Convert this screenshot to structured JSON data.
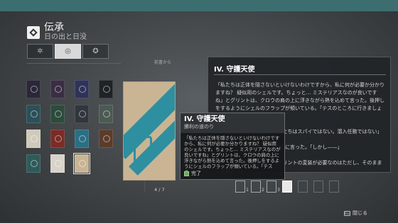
{
  "header": {
    "title": "伝承",
    "subtitle": "日の出と日没"
  },
  "filters": [
    {
      "name": "filter-tab-1",
      "glyph": "✲",
      "selected": false
    },
    {
      "name": "filter-tab-2",
      "glyph": "◎",
      "selected": true
    },
    {
      "name": "filter-tab-3",
      "glyph": "✪",
      "selected": false
    }
  ],
  "books": [
    {
      "color": "#2b2638"
    },
    {
      "color": "#3a2e44"
    },
    {
      "color": "#2f3358"
    },
    {
      "color": "#1f2226"
    },
    {
      "color": "#2a5058"
    },
    {
      "color": "#2c4b3c"
    },
    {
      "color": "#31363e"
    },
    {
      "color": "#4b5a52"
    },
    {
      "color": "#d0cabb"
    },
    {
      "color": "#7a2c25"
    },
    {
      "color": "#2a6f85"
    },
    {
      "color": "#5b3c2a"
    },
    {
      "color": "#2e5a5a"
    },
    {
      "color": "#d8d3c8"
    },
    {
      "color": "#c9b594",
      "selected": true
    }
  ],
  "previous_label": "前書から",
  "detail": {
    "title": "IV. 守護天使",
    "body": "「私たちは正体を隠さないといけないわけですから、私に何が必要か分かりますね？ 疑似用のシェルです。ちょっと… ミステリアスなのが良いですね」とグリントは、クロウの肩の上に浮きながら熱を込めて言った。後押しをするようにシェルのフラップが傾いている。「テスのところに行きましょう」\n\n「……」クロウは言った。「私たちはスパイではない。潜入任務ではない」\n\n…グリントは肩をすくめるように言った。「しかし——」\n\n「……」クロウは言った。「グリントの変装が必要なのはただし、そのままでも目立つ」"
  },
  "tooltip": {
    "title": "IV. 守護天使",
    "subtitle": "勝利の道のり",
    "body": "「私たちは正体を隠さないといけないわけですから、私に何が必要か分かりますね？ 疑似用のシェルです。ちょっと… ミステリアスなのが良いですね」とグリントは、クロウの肩の上に浮きながら熱を込めて言った。後押しをするようにシェルのフラップが傾いている。「テスの…",
    "status": "完了"
  },
  "page_indicator": "4 / 7",
  "pages": [
    {
      "label": "1",
      "state": "read"
    },
    {
      "label": "2",
      "state": "read"
    },
    {
      "label": "3",
      "state": "read"
    },
    {
      "label": "",
      "state": "active"
    },
    {
      "label": "",
      "state": "locked"
    },
    {
      "label": "",
      "state": "locked"
    },
    {
      "label": "",
      "state": "locked"
    }
  ],
  "close": {
    "key": "Esc",
    "label": "閉じる"
  }
}
